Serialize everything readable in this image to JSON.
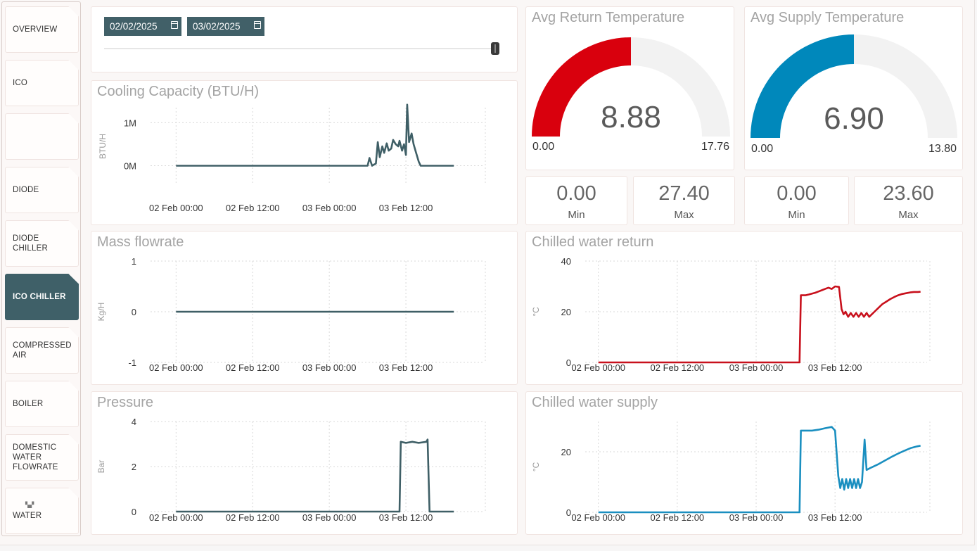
{
  "sidebar": {
    "items": [
      {
        "label": "OVERVIEW",
        "active": false
      },
      {
        "label": "ICO",
        "active": false
      },
      {
        "label": "",
        "active": false
      },
      {
        "label": "DIODE",
        "active": false
      },
      {
        "label": "DIODE\nCHILLER",
        "active": false
      },
      {
        "label": "ICO CHILLER",
        "active": true
      },
      {
        "label": "COMPRESSED\nAIR",
        "active": false
      },
      {
        "label": "BOILER",
        "active": false
      },
      {
        "label": "DOMESTIC\nWATER\nFLOWRATE",
        "active": false
      },
      {
        "label": "WATER",
        "active": false
      }
    ]
  },
  "date_range": {
    "start": "02/02/2025",
    "end": "03/02/2025",
    "slider_position": 1.0
  },
  "gauges": {
    "return": {
      "title": "Avg Return Temperature",
      "value": "8.88",
      "min": "0.00",
      "max": "17.76",
      "fraction": 0.5,
      "color": "#d9000d"
    },
    "supply": {
      "title": "Avg Supply Temperature",
      "value": "6.90",
      "min": "0.00",
      "max": "13.80",
      "fraction": 0.5,
      "color": "#0088bb"
    }
  },
  "stats": {
    "return_min": {
      "value": "0.00",
      "label": "Min"
    },
    "return_max": {
      "value": "27.40",
      "label": "Max"
    },
    "supply_min": {
      "value": "0.00",
      "label": "Min"
    },
    "supply_max": {
      "value": "23.60",
      "label": "Max"
    }
  },
  "chart_data": [
    {
      "id": "cooling",
      "type": "line",
      "title": "Cooling Capacity (BTU/H)",
      "ylabel": "BTU/H",
      "ylim": [
        -0.45,
        1.35
      ],
      "yticks": [
        {
          "v": 0,
          "label": "0M"
        },
        {
          "v": 1,
          "label": "1M"
        }
      ],
      "xticks": [
        {
          "v": 0,
          "label": "02 Feb 00:00"
        },
        {
          "v": 12,
          "label": "02 Feb 12:00"
        },
        {
          "v": 24,
          "label": "03 Feb 00:00"
        },
        {
          "v": 36,
          "label": "03 Feb 12:00"
        }
      ],
      "xlim": [
        -4,
        48
      ],
      "grid": true,
      "color": "#3f5f66",
      "series": [
        {
          "points": [
            [
              0,
              0
            ],
            [
              30,
              0
            ],
            [
              30.3,
              0.18
            ],
            [
              30.7,
              0
            ],
            [
              31.3,
              0.05
            ],
            [
              31.6,
              0.55
            ],
            [
              31.9,
              0.2
            ],
            [
              32.3,
              0.45
            ],
            [
              32.6,
              0.3
            ],
            [
              33,
              0.52
            ],
            [
              33.3,
              0.35
            ],
            [
              33.7,
              0.4
            ],
            [
              34,
              0.6
            ],
            [
              34.4,
              0.5
            ],
            [
              34.8,
              0.45
            ],
            [
              35,
              0.58
            ],
            [
              35.4,
              0.35
            ],
            [
              35.7,
              0.5
            ],
            [
              36,
              0.25
            ],
            [
              36.2,
              1.42
            ],
            [
              36.5,
              0.55
            ],
            [
              36.9,
              0.75
            ],
            [
              37.2,
              0.5
            ],
            [
              37.6,
              0.3
            ],
            [
              38,
              0.1
            ],
            [
              38.3,
              0
            ],
            [
              43.5,
              0
            ]
          ]
        }
      ]
    },
    {
      "id": "mass",
      "type": "line",
      "title": "Mass flowrate",
      "ylabel": "Kg/H",
      "ylim": [
        -1,
        1
      ],
      "yticks": [
        {
          "v": -1,
          "label": "-1"
        },
        {
          "v": 0,
          "label": "0"
        },
        {
          "v": 1,
          "label": "1"
        }
      ],
      "xticks": [
        {
          "v": 0,
          "label": "02 Feb 00:00"
        },
        {
          "v": 12,
          "label": "02 Feb 12:00"
        },
        {
          "v": 24,
          "label": "03 Feb 00:00"
        },
        {
          "v": 36,
          "label": "03 Feb 12:00"
        }
      ],
      "xlim": [
        -4,
        48
      ],
      "grid": true,
      "color": "#3f5f66",
      "series": [
        {
          "points": [
            [
              0,
              0
            ],
            [
              43.5,
              0
            ]
          ]
        }
      ]
    },
    {
      "id": "pressure",
      "type": "line",
      "title": "Pressure",
      "ylabel": "Bar",
      "ylim": [
        0,
        4
      ],
      "yticks": [
        {
          "v": 0,
          "label": "0"
        },
        {
          "v": 2,
          "label": "2"
        },
        {
          "v": 4,
          "label": "4"
        }
      ],
      "xticks": [
        {
          "v": 0,
          "label": "02 Feb 00:00"
        },
        {
          "v": 12,
          "label": "02 Feb 12:00"
        },
        {
          "v": 24,
          "label": "03 Feb 00:00"
        },
        {
          "v": 36,
          "label": "03 Feb 12:00"
        }
      ],
      "xlim": [
        -4,
        48
      ],
      "grid": true,
      "color": "#3f5f66",
      "series": [
        {
          "points": [
            [
              0,
              0
            ],
            [
              35,
              0
            ],
            [
              35.2,
              3.1
            ],
            [
              36,
              3.05
            ],
            [
              37,
              3.1
            ],
            [
              38,
              3.05
            ],
            [
              39.2,
              3.1
            ],
            [
              39.4,
              3.2
            ],
            [
              39.7,
              0
            ],
            [
              43.5,
              0
            ]
          ]
        }
      ]
    },
    {
      "id": "return",
      "type": "line",
      "title": "Chilled water return",
      "ylabel": "°C",
      "ylim": [
        0,
        40
      ],
      "yticks": [
        {
          "v": 0,
          "label": "0"
        },
        {
          "v": 20,
          "label": "20"
        },
        {
          "v": 40,
          "label": "40"
        }
      ],
      "xticks": [
        {
          "v": 0,
          "label": "02 Feb 00:00"
        },
        {
          "v": 12,
          "label": "02 Feb 12:00"
        },
        {
          "v": 24,
          "label": "03 Feb 00:00"
        },
        {
          "v": 36,
          "label": "03 Feb 12:00"
        }
      ],
      "xlim": [
        -2,
        50
      ],
      "grid": true,
      "color": "#c8101c",
      "series": [
        {
          "points": [
            [
              0,
              0
            ],
            [
              30.6,
              0
            ],
            [
              30.8,
              26.5
            ],
            [
              31.5,
              26.5
            ],
            [
              32,
              26.8
            ],
            [
              33,
              27.5
            ],
            [
              33.5,
              28
            ],
            [
              34,
              28.5
            ],
            [
              34.5,
              29
            ],
            [
              35,
              29.5
            ],
            [
              35.5,
              29
            ],
            [
              36,
              30
            ],
            [
              36.6,
              29.8
            ],
            [
              37,
              21
            ],
            [
              37.3,
              19
            ],
            [
              37.6,
              20
            ],
            [
              38,
              18
            ],
            [
              38.4,
              19.5
            ],
            [
              38.8,
              18
            ],
            [
              39.2,
              19.5
            ],
            [
              39.6,
              18
            ],
            [
              40,
              19.5
            ],
            [
              40.4,
              18
            ],
            [
              40.8,
              19.5
            ],
            [
              41.2,
              18
            ],
            [
              41.6,
              19
            ],
            [
              42,
              20
            ],
            [
              42.6,
              21.5
            ],
            [
              43.2,
              23
            ],
            [
              43.8,
              24
            ],
            [
              44.4,
              25
            ],
            [
              45,
              25.8
            ],
            [
              45.6,
              26.5
            ],
            [
              46.2,
              27
            ],
            [
              46.8,
              27.3
            ],
            [
              47.4,
              27.6
            ],
            [
              48,
              27.8
            ],
            [
              48.6,
              27.8
            ],
            [
              49,
              27.9
            ]
          ]
        }
      ]
    },
    {
      "id": "supply",
      "type": "line",
      "title": "Chilled water supply",
      "ylabel": "°C",
      "ylim": [
        0,
        30
      ],
      "yticks": [
        {
          "v": 0,
          "label": "0"
        },
        {
          "v": 20,
          "label": "20"
        }
      ],
      "xticks": [
        {
          "v": 0,
          "label": "02 Feb 00:00"
        },
        {
          "v": 12,
          "label": "02 Feb 12:00"
        },
        {
          "v": 24,
          "label": "03 Feb 00:00"
        },
        {
          "v": 36,
          "label": "03 Feb 12:00"
        }
      ],
      "xlim": [
        -2,
        50
      ],
      "grid": true,
      "color": "#1a8fc0",
      "series": [
        {
          "points": [
            [
              0,
              0
            ],
            [
              30.6,
              0
            ],
            [
              30.8,
              27
            ],
            [
              31.5,
              27
            ],
            [
              32.5,
              27
            ],
            [
              33.5,
              27.3
            ],
            [
              34.5,
              27.8
            ],
            [
              35.5,
              28.2
            ],
            [
              36,
              27
            ],
            [
              36.5,
              12
            ],
            [
              36.8,
              8
            ],
            [
              37.1,
              11
            ],
            [
              37.4,
              7.5
            ],
            [
              37.7,
              11
            ],
            [
              38,
              8
            ],
            [
              38.3,
              11
            ],
            [
              38.6,
              8
            ],
            [
              38.9,
              11
            ],
            [
              39.2,
              8
            ],
            [
              39.5,
              11
            ],
            [
              39.8,
              8
            ],
            [
              40.1,
              10
            ],
            [
              40.5,
              24
            ],
            [
              40.8,
              14
            ],
            [
              41.5,
              14.8
            ],
            [
              42.5,
              15.8
            ],
            [
              43.5,
              17
            ],
            [
              44.5,
              18.2
            ],
            [
              45.5,
              19.3
            ],
            [
              46.5,
              20.3
            ],
            [
              47.5,
              21.2
            ],
            [
              48.5,
              21.8
            ],
            [
              49,
              22
            ]
          ]
        }
      ]
    }
  ]
}
